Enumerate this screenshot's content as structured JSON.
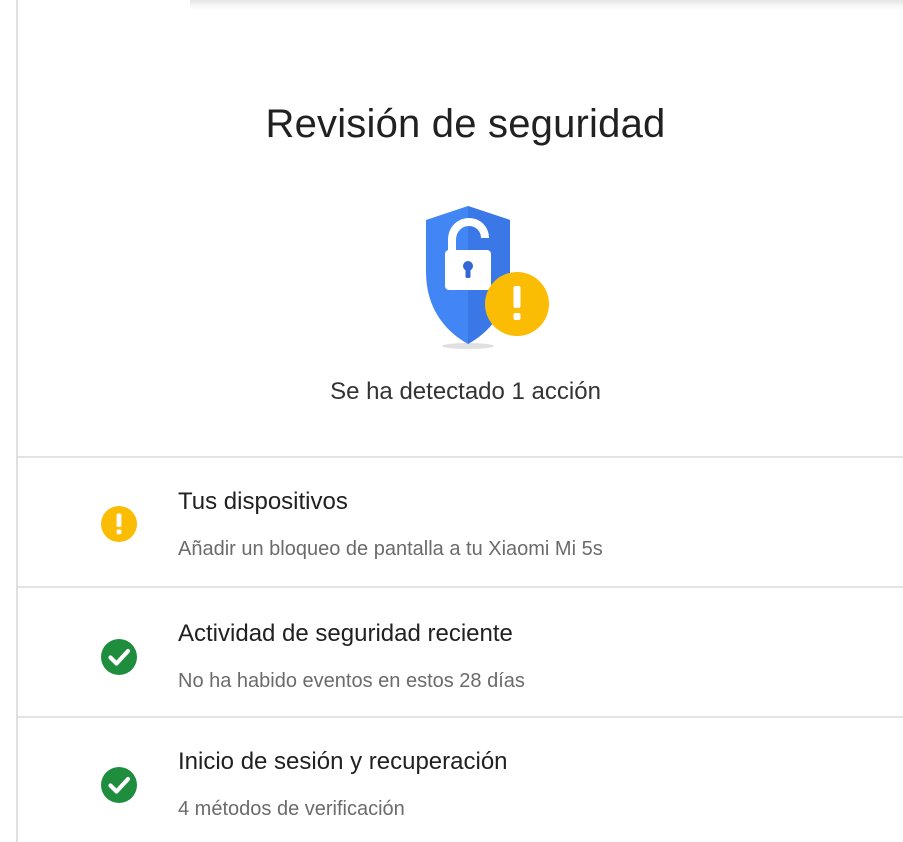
{
  "header": {
    "title": "Revisión de seguridad",
    "summary": "Se ha detectado 1 acción"
  },
  "hero_icon": "shield-unlocked-warning-icon",
  "colors": {
    "shield_blue": "#4285f4",
    "shield_blue_dark": "#3367d6",
    "warning_yellow": "#fbbc04",
    "ok_green": "#1e8e3e",
    "title_text": "#212121",
    "subtitle_text": "#6b6b6b",
    "divider": "#e3e3e3"
  },
  "items": [
    {
      "status": "warning",
      "icon": "warning-icon",
      "title": "Tus dispositivos",
      "subtitle": "Añadir un bloqueo de pantalla a tu Xiaomi Mi 5s"
    },
    {
      "status": "ok",
      "icon": "check-icon",
      "title": "Actividad de seguridad reciente",
      "subtitle": "No ha habido eventos en estos 28 días"
    },
    {
      "status": "ok",
      "icon": "check-icon",
      "title": "Inicio de sesión y recuperación",
      "subtitle": "4 métodos de verificación"
    }
  ]
}
